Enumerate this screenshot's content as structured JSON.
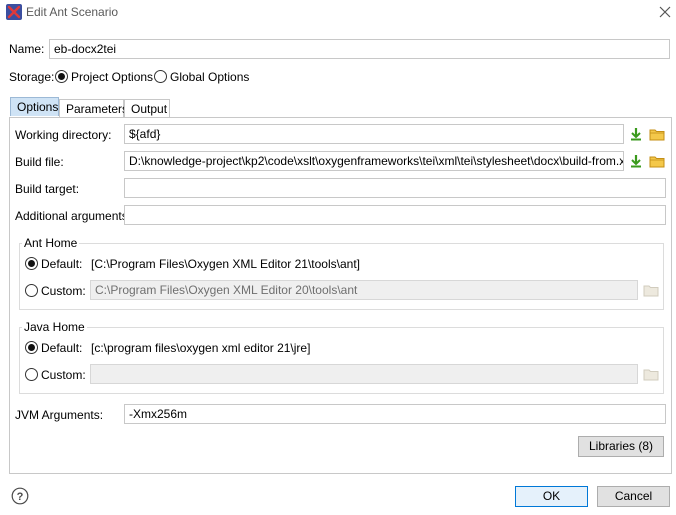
{
  "window": {
    "title": "Edit Ant Scenario"
  },
  "name": {
    "label": "Name:",
    "value": "eb-docx2tei"
  },
  "storage": {
    "label": "Storage:",
    "options": [
      "Project Options",
      "Global Options"
    ],
    "selected": "Project Options"
  },
  "tabs": [
    {
      "label": "Options",
      "active": true
    },
    {
      "label": "Parameters",
      "active": false
    },
    {
      "label": "Output",
      "active": false
    }
  ],
  "options": {
    "working_directory": {
      "label": "Working directory:",
      "value": "${afd}"
    },
    "build_file": {
      "label": "Build file:",
      "value": "D:\\knowledge-project\\kp2\\code\\xslt\\oxygenframeworks\\tei\\xml\\tei\\stylesheet\\docx\\build-from.xml"
    },
    "build_target": {
      "label": "Build target:",
      "value": ""
    },
    "additional_arguments": {
      "label": "Additional arguments:",
      "value": ""
    },
    "ant_home": {
      "title": "Ant Home",
      "default_label": "Default:",
      "default_value": "[C:\\Program Files\\Oxygen XML Editor 21\\tools\\ant]",
      "custom_label": "Custom:",
      "custom_value": "C:\\Program Files\\Oxygen XML Editor 20\\tools\\ant",
      "selected": "Default"
    },
    "java_home": {
      "title": "Java Home",
      "default_label": "Default:",
      "default_value": "[c:\\program files\\oxygen xml editor 21\\jre]",
      "custom_label": "Custom:",
      "custom_value": "",
      "selected": "Default"
    },
    "jvm_arguments": {
      "label": "JVM Arguments:",
      "value": "-Xmx256m"
    },
    "libraries_label": "Libraries (8)"
  },
  "footer": {
    "ok_label": "OK",
    "cancel_label": "Cancel"
  },
  "colors": {
    "accent": "#0078d7",
    "tab_active": "#cfe3f5",
    "download_arrow": "#3a9a1c",
    "folder": "#e8b33a"
  }
}
